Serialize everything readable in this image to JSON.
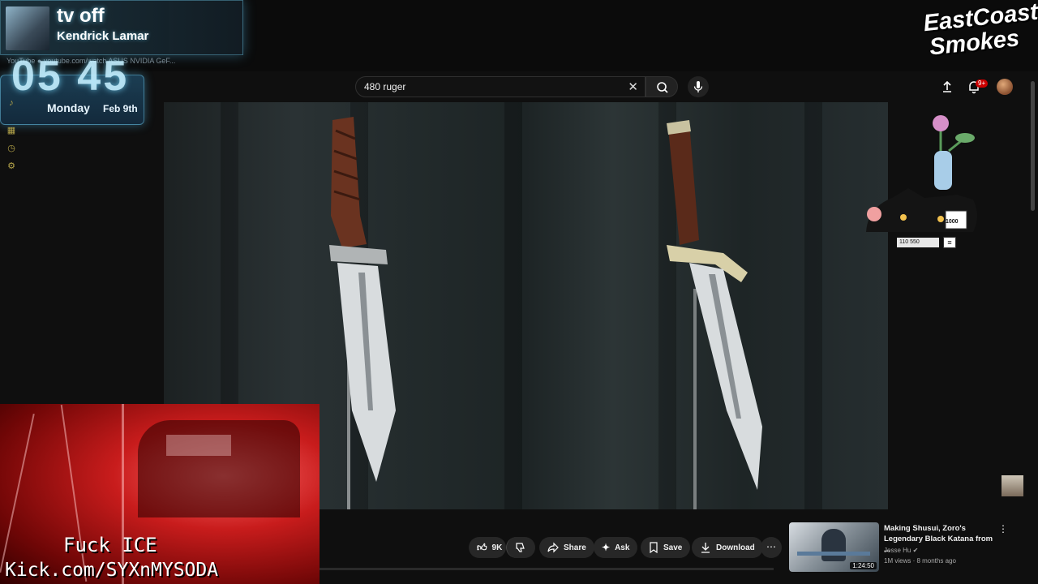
{
  "now_playing": {
    "title": "tv off",
    "artist": "Kendrick Lamar"
  },
  "browser_tabs_faint": "YouTube    ● youtube.com/watch    ASUS NVIDIA GeF...",
  "clock": {
    "time": "05 45",
    "day": "Monday",
    "date": "Feb 9th"
  },
  "brand_logo": {
    "line1": "EastCoast",
    "line2": "Smokes"
  },
  "search": {
    "value": "480 ruger",
    "clear_icon": "close-icon",
    "search_icon": "search-icon"
  },
  "header": {
    "notification_count": "9+",
    "icons": [
      "upload-icon",
      "bell-icon",
      "avatar"
    ]
  },
  "overlay_widget": {
    "stat": "110 550",
    "counter": "1000"
  },
  "webcam": {
    "line1": "Fuck ICE",
    "line2": "Kick.com/SYXnMYSODA"
  },
  "actions": {
    "like_count": "9K",
    "share": "Share",
    "ask": "Ask",
    "save": "Save",
    "download": "Download"
  },
  "recommendation": {
    "title": "Making Shusui, Zoro's Legendary Black Katana from ...",
    "channel": "Jesse Hu",
    "meta": "1M views · 8 months ago",
    "duration": "1:24:50"
  },
  "colors": {
    "accent_red": "#cc0000",
    "chip_bg": "#272727",
    "cyan_glow": "#78dcff"
  }
}
